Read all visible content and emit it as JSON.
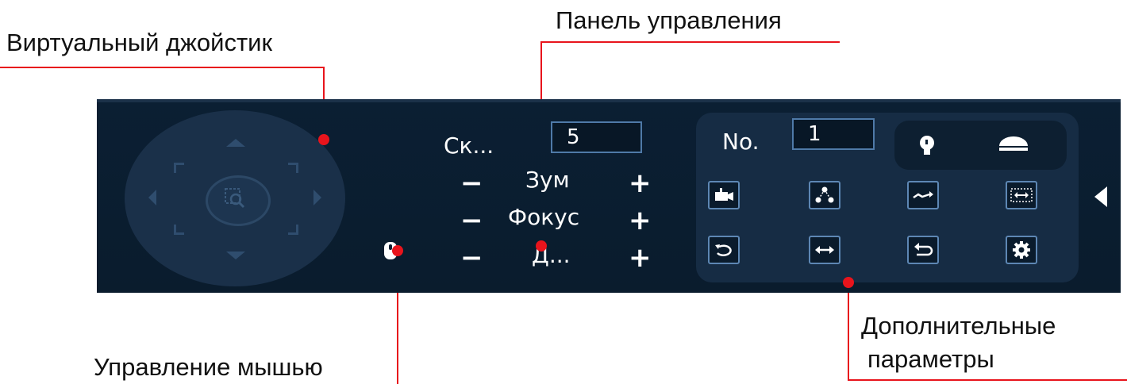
{
  "annotations": {
    "virtual_joystick": "Виртуальный джойстик",
    "control_panel": "Панель управления",
    "mouse_control": "Управление мышью",
    "extra_params_line1": "Дополнительные",
    "extra_params_line2": "параметры"
  },
  "panel": {
    "speed": {
      "label": "Ск...",
      "value": "5"
    },
    "controls": [
      {
        "minus": "−",
        "label": "Зум",
        "plus": "+"
      },
      {
        "minus": "−",
        "label": "Фокус",
        "plus": "+"
      },
      {
        "minus": "−",
        "label": "Д...",
        "plus": "+"
      }
    ],
    "preset": {
      "label": "No.",
      "value": "1"
    }
  },
  "colors": {
    "panel_bg": "#0b1f33",
    "accent_border": "#5d87b4",
    "annotation_red": "#e8141c"
  },
  "icons": [
    "joystick-zoom-icon",
    "mouse-icon",
    "light-icon",
    "wiper-icon",
    "preset-camera-icon",
    "tour-icon",
    "pattern-icon",
    "scan-icon",
    "rotate-icon",
    "pan-icon",
    "flip-icon",
    "settings-icon",
    "collapse-arrow-icon"
  ]
}
